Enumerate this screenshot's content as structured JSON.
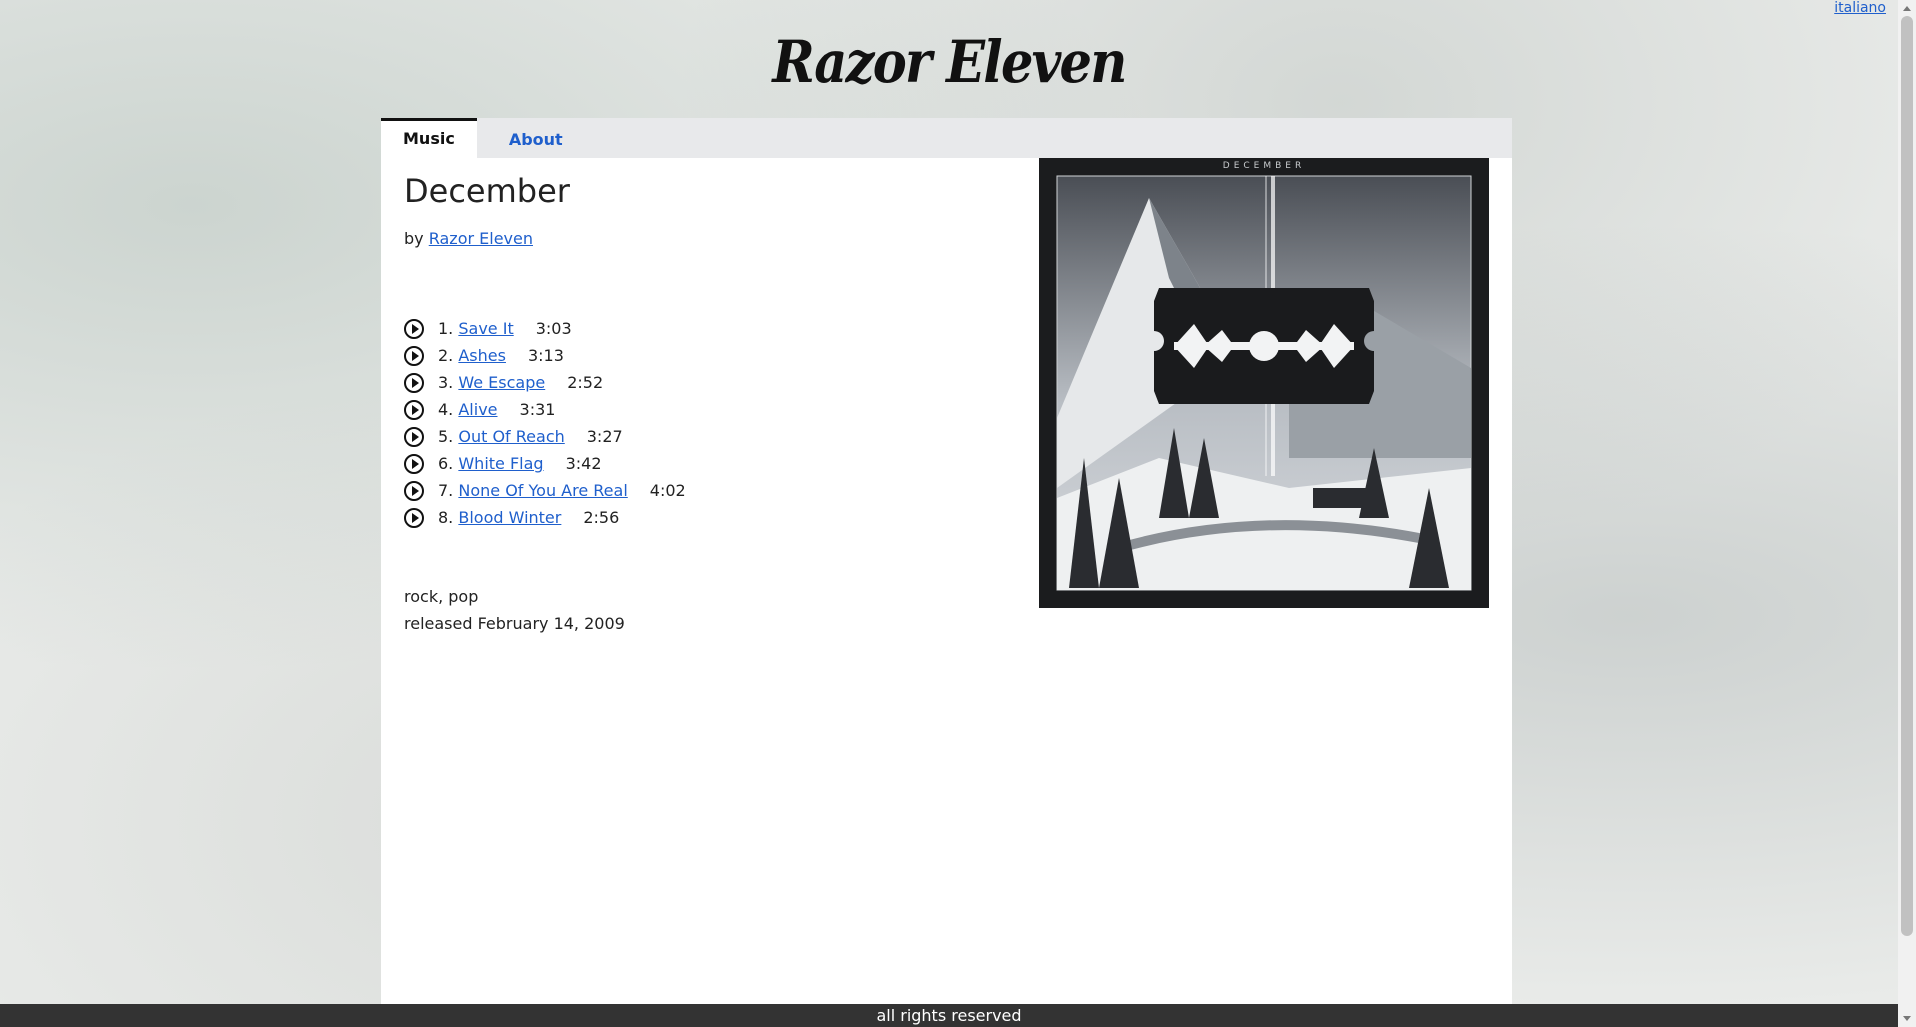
{
  "language_link": "italiano",
  "site_title": "Razor Eleven",
  "tabs": [
    {
      "label": "Music",
      "active": true
    },
    {
      "label": "About",
      "active": false
    }
  ],
  "album": {
    "title": "December",
    "by_prefix": "by",
    "artist": "Razor Eleven",
    "cover_text": "DECEMBER",
    "tracks": [
      {
        "number": "1.",
        "title": "Save It",
        "duration": "3:03"
      },
      {
        "number": "2.",
        "title": "Ashes",
        "duration": "3:13"
      },
      {
        "number": "3.",
        "title": "We Escape",
        "duration": "2:52"
      },
      {
        "number": "4.",
        "title": "Alive",
        "duration": "3:31"
      },
      {
        "number": "5.",
        "title": "Out Of Reach",
        "duration": "3:27"
      },
      {
        "number": "6.",
        "title": "White Flag",
        "duration": "3:42"
      },
      {
        "number": "7.",
        "title": "None Of You Are Real",
        "duration": "4:02"
      },
      {
        "number": "8.",
        "title": "Blood Winter",
        "duration": "2:56"
      }
    ],
    "genres": "rock, pop",
    "released": "released February 14, 2009"
  },
  "footer": "all rights reserved",
  "colors": {
    "link": "#1f5fcc",
    "footer_bg": "#333333",
    "tab_bar": "#e8e9eb"
  }
}
